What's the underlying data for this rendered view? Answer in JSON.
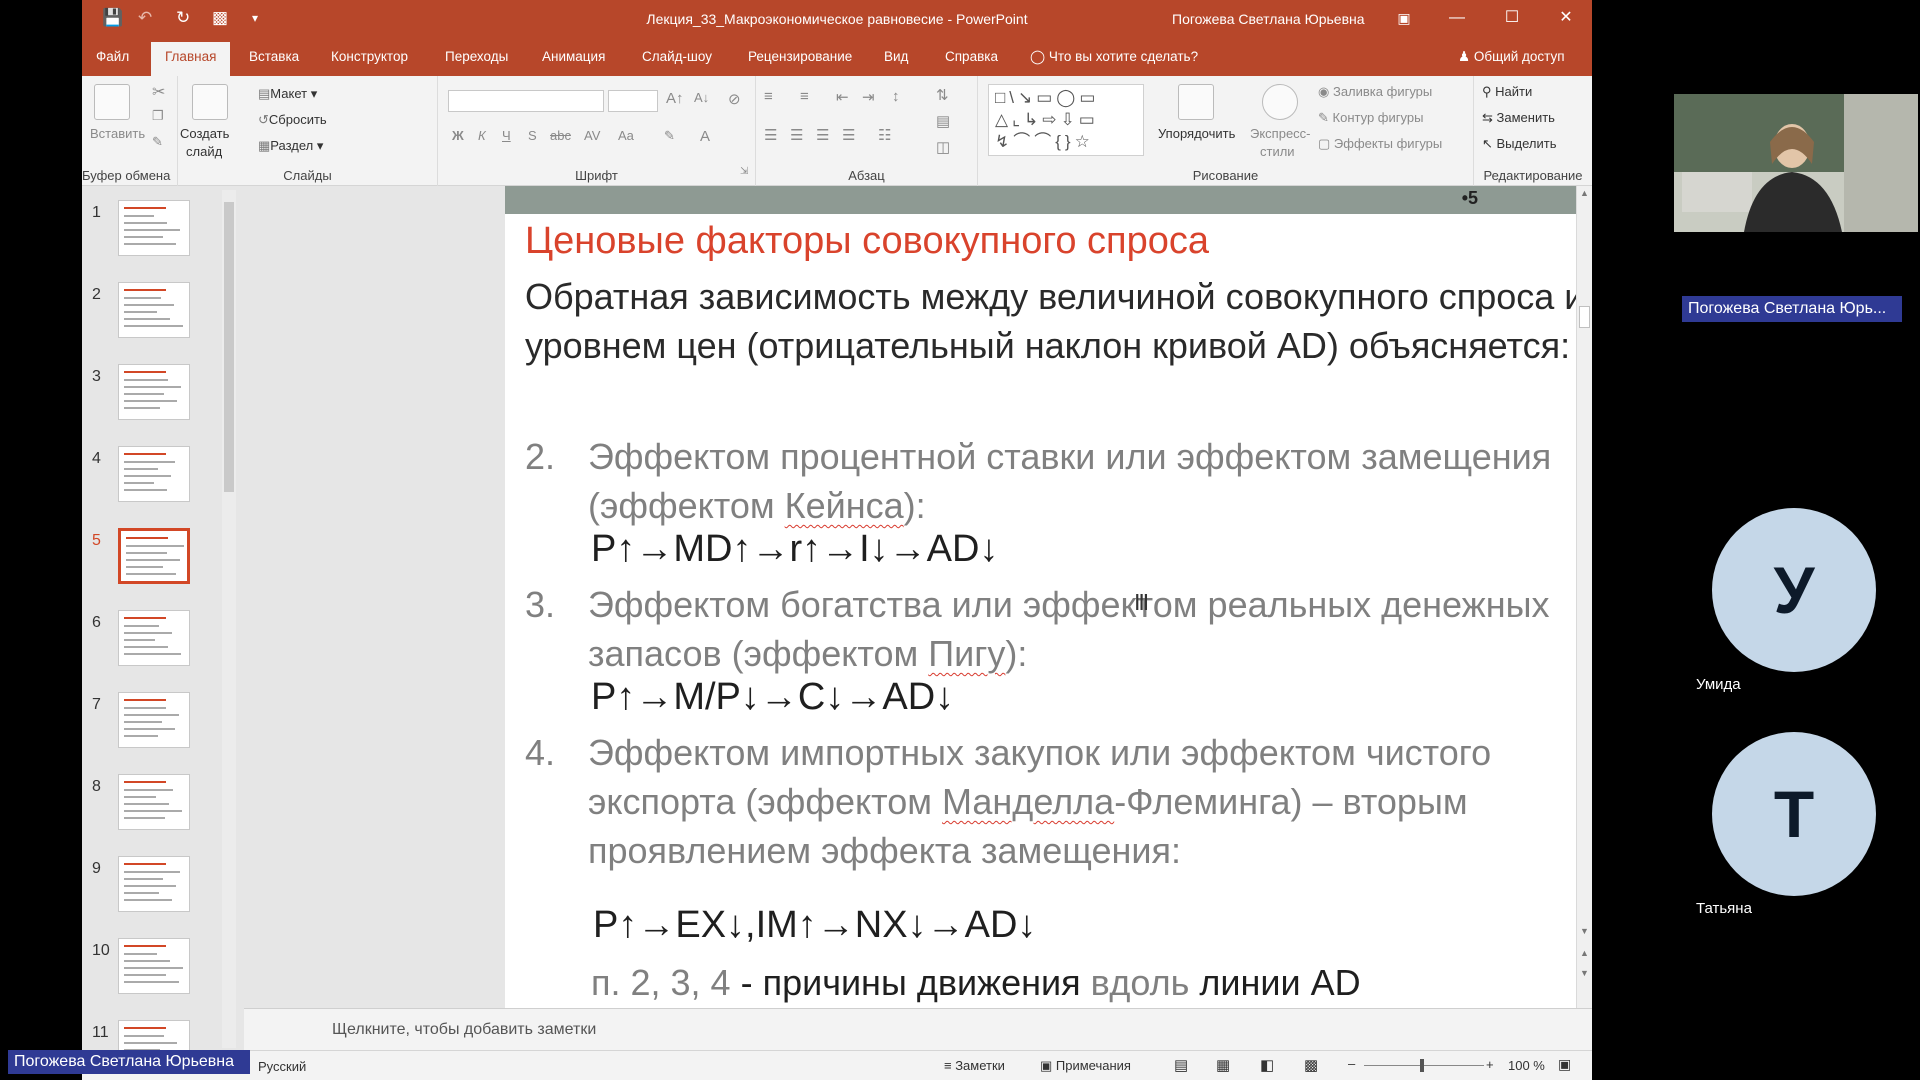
{
  "window": {
    "title": "Лекция_33_Макроэкономическое равновесие  -  PowerPoint",
    "user": "Погожева Светлана Юрьевна"
  },
  "tabs": [
    "Файл",
    "Главная",
    "Вставка",
    "Конструктор",
    "Переходы",
    "Анимация",
    "Слайд-шоу",
    "Рецензирование",
    "Вид",
    "Справка",
    "Что вы хотите сделать?"
  ],
  "share_label": "Общий доступ",
  "ribbon": {
    "clipboard": {
      "paste": "Вставить",
      "label": "Буфер обмена"
    },
    "slides": {
      "create": "Создать",
      "create2": "слайд",
      "layout": "Макет",
      "reset": "Сбросить",
      "section": "Раздел",
      "label": "Слайды"
    },
    "font": {
      "label": "Шрифт"
    },
    "paragraph": {
      "label": "Абзац"
    },
    "drawing": {
      "arrange": "Упорядочить",
      "quick_styles": "Экспресс-",
      "quick_styles2": "стили",
      "fill": "Заливка фигуры",
      "outline": "Контур фигуры",
      "effects": "Эффекты фигуры",
      "label": "Рисование"
    },
    "editing": {
      "find": "Найти",
      "replace": "Заменить",
      "select": "Выделить",
      "label": "Редактирование"
    }
  },
  "thumbnails": {
    "numbers": [
      "1",
      "2",
      "3",
      "4",
      "5",
      "6",
      "7",
      "8",
      "9",
      "10",
      "11"
    ],
    "selected": 5
  },
  "slide": {
    "number": "•5",
    "title": "Ценовые факторы совокупного спроса",
    "intro": "Обратная зависимость между величиной совокупного спроса и уровнем цен (отрицательный наклон кривой AD) объясняется:",
    "items": [
      {
        "num": "2.",
        "pre": "Эффектом процентной ставки или эффектом замещения (эффектом ",
        "name": "Кейнса",
        "post": "):",
        "formula": "P↑→MD↑→r↑→I↓→AD↓"
      },
      {
        "num": "3.",
        "pre": "Эффектом богатства или эффектом реальных денежных запасов (эффектом ",
        "name": "Пигу",
        "post": "):",
        "formula": "P↑→M/P↓→C↓→AD↓"
      },
      {
        "num": "4.",
        "pre": "Эффектом импортных закупок или эффектом чистого экспорта (эффектом ",
        "name": "Манделла",
        "post": "-Флеминга) – вторым проявлением эффекта замещения:",
        "formula": "P↑→EX↓,IM↑→NX↓→AD↓"
      }
    ],
    "footer_a": "п. 2, 3, 4",
    "footer_b": " - причины движения ",
    "footer_c": "вдоль",
    "footer_d": " линии AD"
  },
  "notes_hint": "Щелкните, чтобы добавить заметки",
  "status": {
    "language": "Русский",
    "notes": "Заметки",
    "comments": "Примечания",
    "zoom": "100 %"
  },
  "call": {
    "presenter": "Погожева Светлана Юрь...",
    "participants": [
      {
        "initial": "У",
        "name": "Умида"
      },
      {
        "initial": "Т",
        "name": "Татьяна"
      }
    ],
    "bottom_tag": "Погожева Светлана Юрьевна"
  },
  "colors": {
    "accent": "#b7472a",
    "title_red": "#d9432c",
    "nametag": "#2f3a94",
    "avatar": "#c5d7e8"
  }
}
